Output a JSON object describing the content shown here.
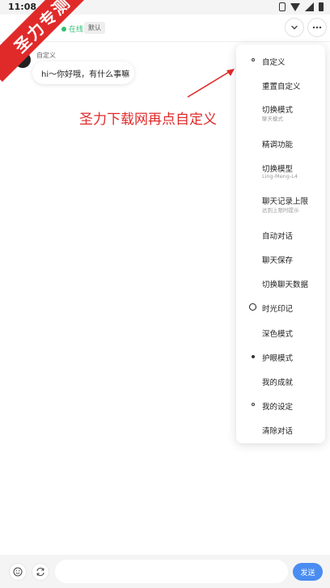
{
  "status_bar": {
    "time": "11:08"
  },
  "header": {
    "online_text": "在线",
    "badge": "默认",
    "chevron_icon": "chevron-down-icon",
    "more_icon": "more-icon"
  },
  "watermark": {
    "text": "圣力专测"
  },
  "chat": {
    "sender": "自定义",
    "message": "hi～你好哦，有什么事嘛"
  },
  "annotation": {
    "text": "圣力下载网再点自定义"
  },
  "menu": {
    "items": [
      {
        "label": "自定义",
        "sub": "",
        "icon": "dot"
      },
      {
        "label": "重置自定义",
        "sub": "",
        "icon": ""
      },
      {
        "label": "切换模式",
        "sub": "聊天模式",
        "icon": ""
      },
      {
        "label": "精调功能",
        "sub": "",
        "icon": ""
      },
      {
        "label": "切换模型",
        "sub": "Ling-Meng-L4",
        "icon": ""
      },
      {
        "label": "聊天记录上限",
        "sub": "达到上限时提示",
        "icon": ""
      },
      {
        "label": "自动对话",
        "sub": "",
        "icon": ""
      },
      {
        "label": "聊天保存",
        "sub": "",
        "icon": ""
      },
      {
        "label": "切换聊天数据",
        "sub": "",
        "icon": ""
      },
      {
        "label": "时光印记",
        "sub": "",
        "icon": "ring"
      },
      {
        "label": "深色模式",
        "sub": "",
        "icon": ""
      },
      {
        "label": "护眼模式",
        "sub": "",
        "icon": "solid"
      },
      {
        "label": "我的成就",
        "sub": "",
        "icon": ""
      },
      {
        "label": "我的设定",
        "sub": "",
        "icon": "dot"
      },
      {
        "label": "清除对话",
        "sub": "",
        "icon": ""
      }
    ]
  },
  "bottom_bar": {
    "emoji_icon": "emoji-icon",
    "refresh_icon": "refresh-icon",
    "input_value": "",
    "send_label": "发送"
  }
}
